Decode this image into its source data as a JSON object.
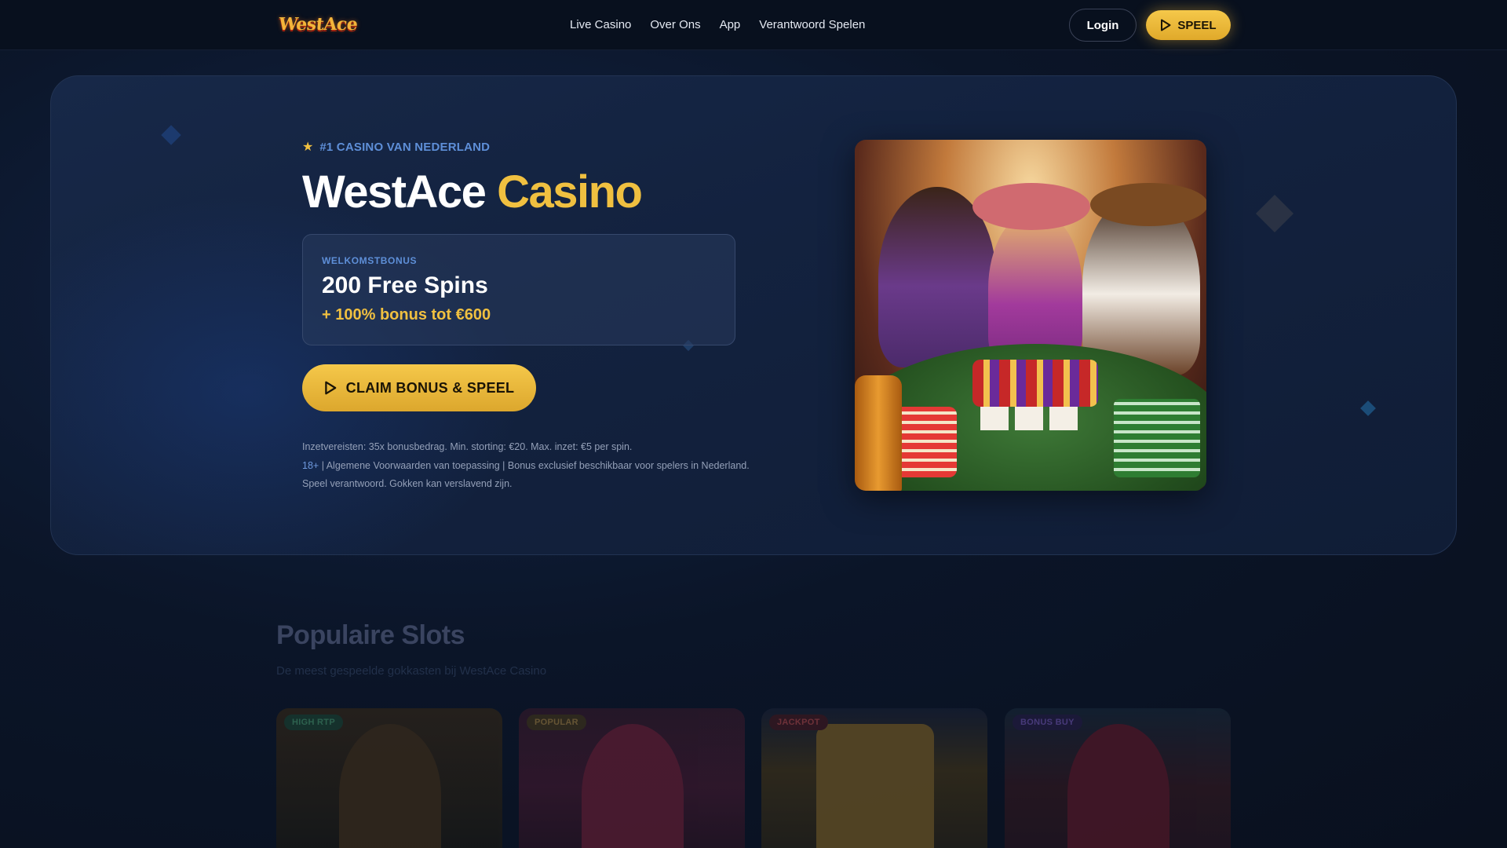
{
  "header": {
    "logo_text": "WestAce",
    "nav": [
      "Live Casino",
      "Over Ons",
      "App",
      "Verantwoord Spelen"
    ],
    "login_label": "Login",
    "play_label": "SPEEL"
  },
  "hero": {
    "tagline": "#1 CASINO VAN NEDERLAND",
    "title_main": "WestAce",
    "title_accent": "Casino",
    "bonus_label": "WELKOMSTBONUS",
    "bonus_main": "200 Free Spins",
    "bonus_sub": "+ 100% bonus tot €600",
    "cta_label": "CLAIM BONUS & SPEEL",
    "disclaimer_line1": "Inzetvereisten: 35x bonusbedrag. Min. storting: €20. Max. inzet: €5 per spin.",
    "disclaimer_age": "18+",
    "disclaimer_line2": " | Algemene Voorwaarden van toepassing | Bonus exclusief beschikbaar voor spelers in Nederland.",
    "disclaimer_line3": "Speel verantwoord. Gokken kan verslavend zijn."
  },
  "slots": {
    "title": "Populaire Slots",
    "subtitle": "De meest gespeelde gokkasten bij WestAce Casino",
    "items": [
      {
        "badge": "HIGH RTP"
      },
      {
        "badge": "POPULAR"
      },
      {
        "badge": "JACKPOT"
      },
      {
        "badge": "BONUS BUY"
      }
    ]
  },
  "colors": {
    "accent_gold": "#f0c040",
    "accent_blue": "#5e8fd8",
    "background": "#0a1020"
  }
}
